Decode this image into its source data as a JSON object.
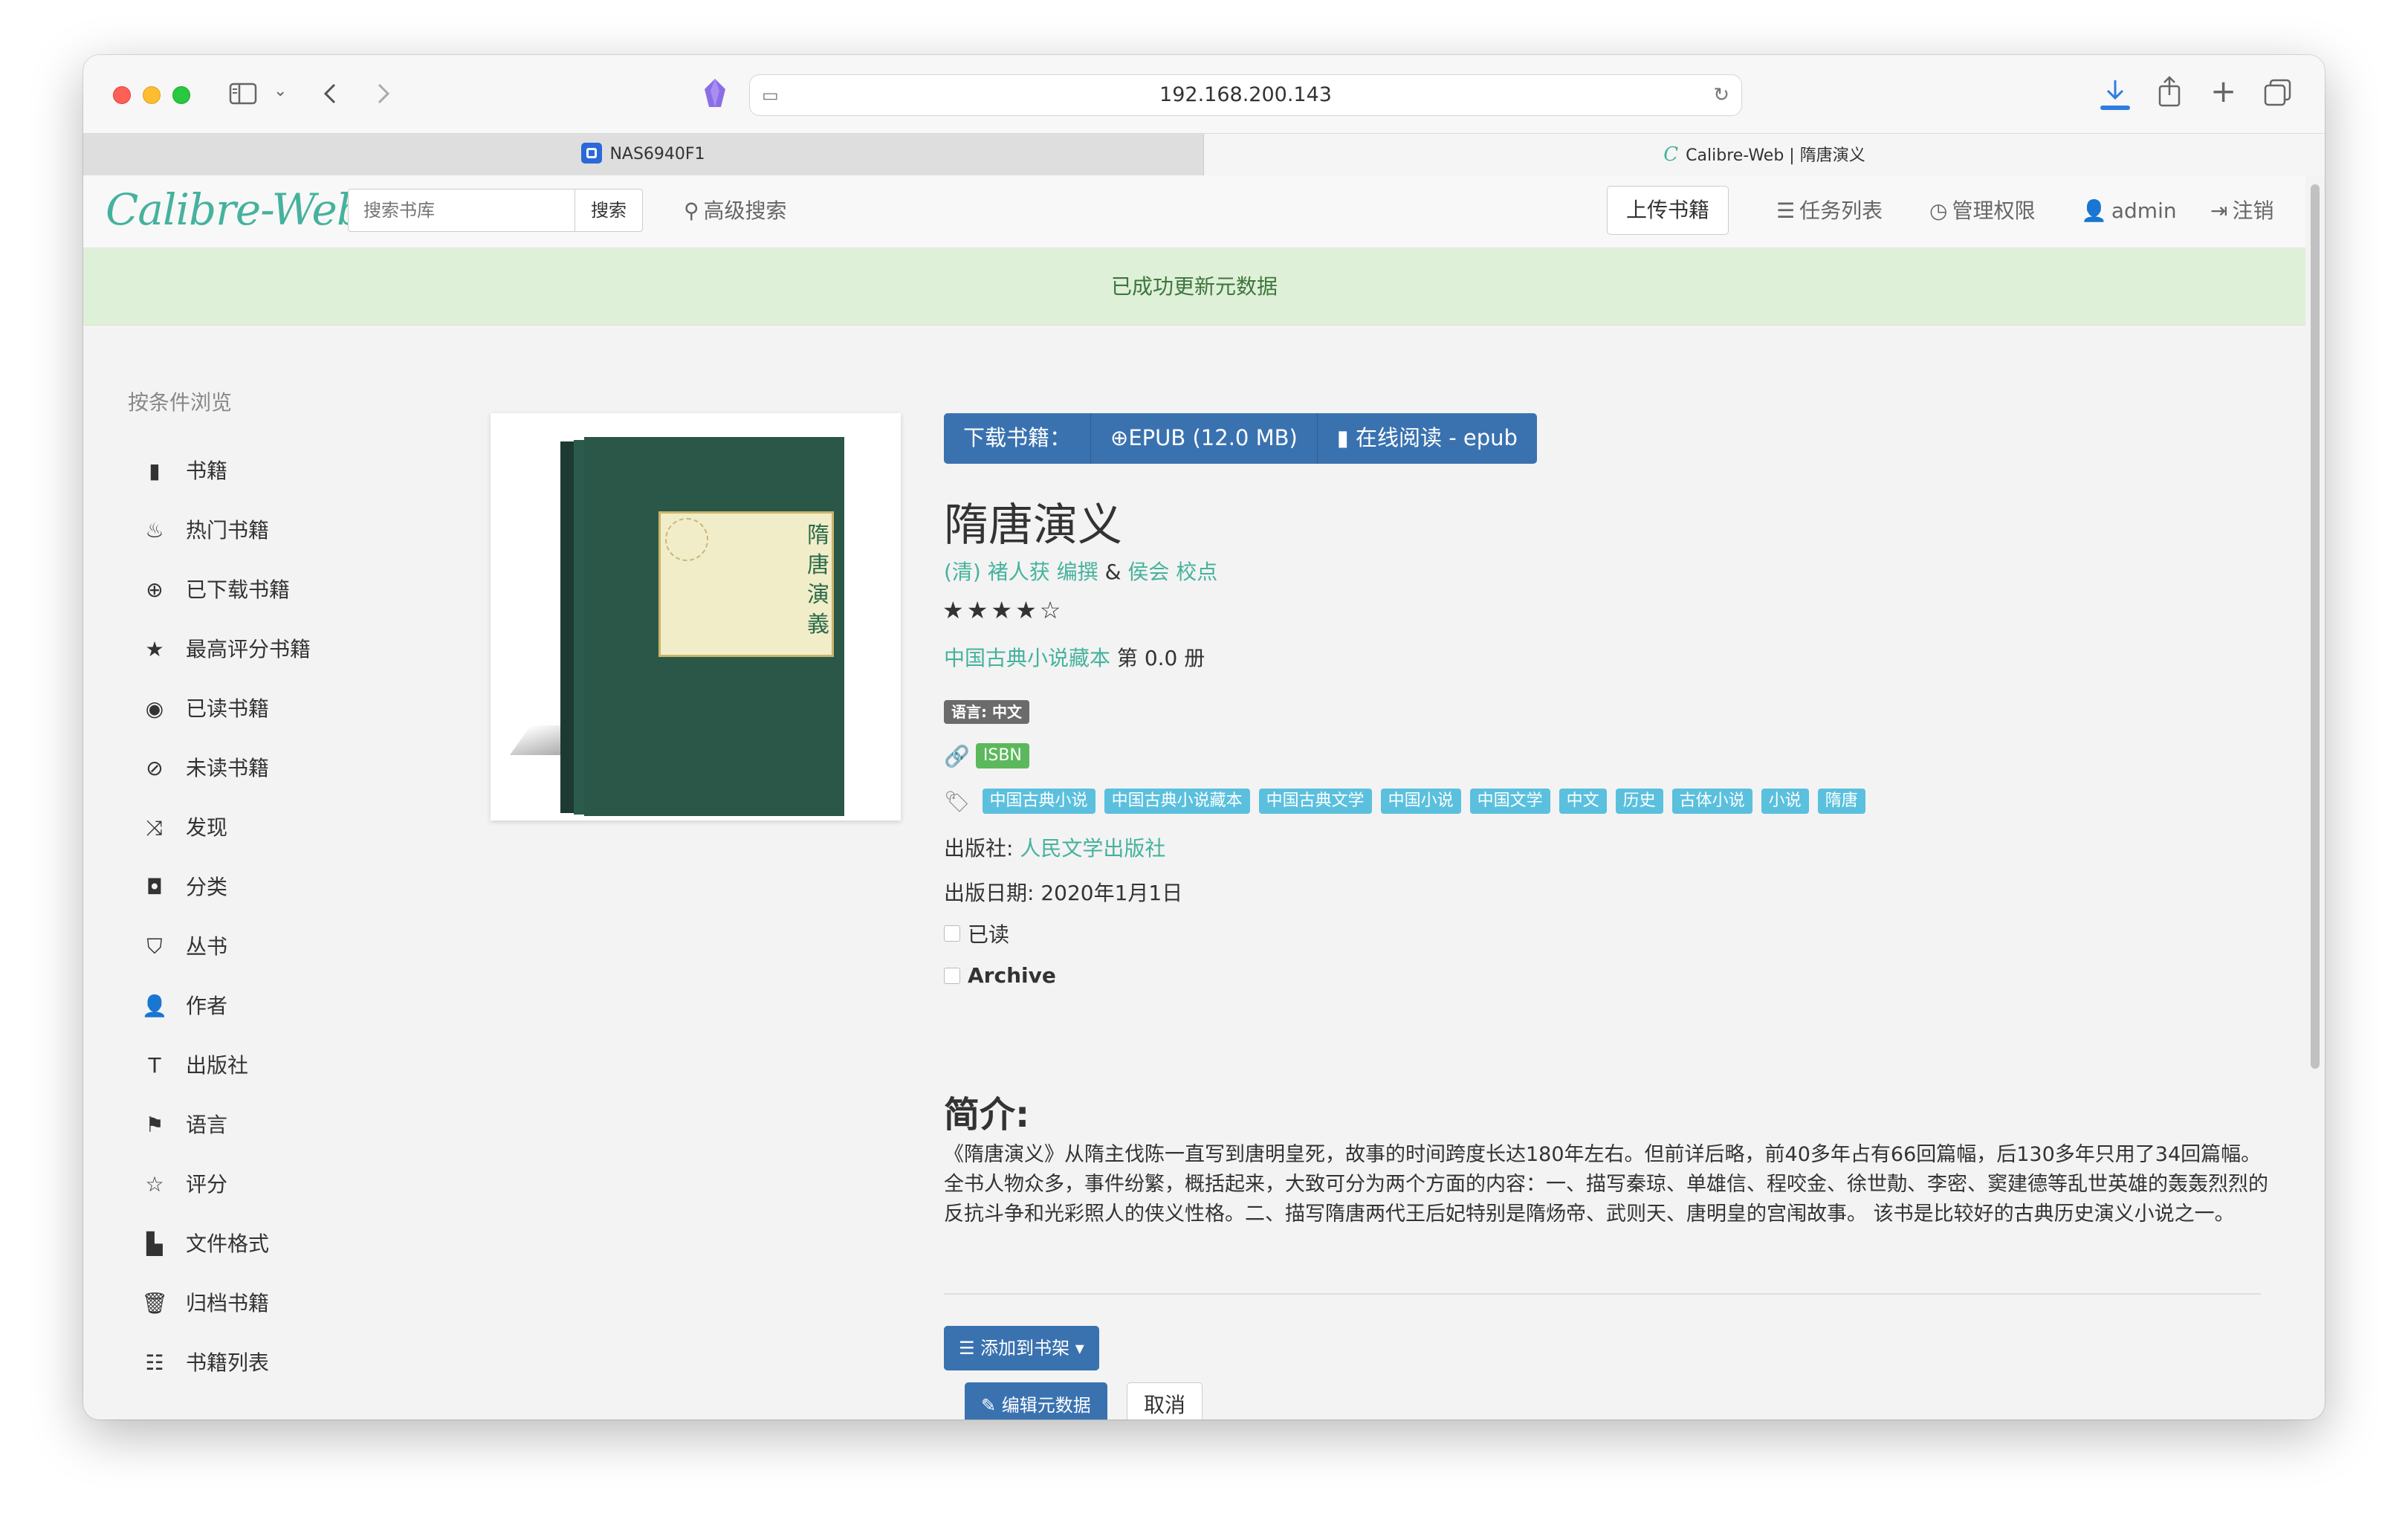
{
  "browser": {
    "url": "192.168.200.143",
    "tabs": [
      {
        "label": "NAS6940F1",
        "active": false
      },
      {
        "label": "Calibre-Web | 隋唐演义",
        "active": true
      }
    ]
  },
  "navbar": {
    "brand": "Calibre-Web",
    "search_placeholder": "搜索书库",
    "search_button": "搜索",
    "advanced_search": "高级搜索",
    "upload": "上传书籍",
    "tasks": "任务列表",
    "admin_rights": "管理权限",
    "user": "admin",
    "logout": "注销"
  },
  "alert": {
    "message": "已成功更新元数据"
  },
  "sidebar": {
    "heading": "按条件浏览",
    "items": [
      {
        "label": "书籍",
        "icon": "book-icon"
      },
      {
        "label": "热门书籍",
        "icon": "fire-icon"
      },
      {
        "label": "已下载书籍",
        "icon": "download-icon"
      },
      {
        "label": "最高评分书籍",
        "icon": "star-icon"
      },
      {
        "label": "已读书籍",
        "icon": "eye-icon"
      },
      {
        "label": "未读书籍",
        "icon": "eye-slash-icon"
      },
      {
        "label": "发现",
        "icon": "shuffle-icon"
      },
      {
        "label": "分类",
        "icon": "inbox-icon"
      },
      {
        "label": "丛书",
        "icon": "bookmark-icon"
      },
      {
        "label": "作者",
        "icon": "user-icon"
      },
      {
        "label": "出版社",
        "icon": "text-size-icon"
      },
      {
        "label": "语言",
        "icon": "flag-icon"
      },
      {
        "label": "评分",
        "icon": "star-empty-icon"
      },
      {
        "label": "文件格式",
        "icon": "file-icon"
      },
      {
        "label": "归档书籍",
        "icon": "trash-icon"
      },
      {
        "label": "书籍列表",
        "icon": "list-icon"
      }
    ]
  },
  "book": {
    "download_label": "下载书籍：",
    "epub_download": "EPUB (12.0 MB)",
    "read_online": "在线阅读 - epub",
    "title": "隋唐演义",
    "author_1": "(清) 褚人获 编撰",
    "author_sep": "&",
    "author_2": "侯会 校点",
    "rating": 4,
    "series_name": "中国古典小说藏本",
    "series_index": "第 0.0 册",
    "language": "语言: 中文",
    "isbn_label": "ISBN",
    "tags": [
      "中国古典小说",
      "中国古典小说藏本",
      "中国古典文学",
      "中国小说",
      "中国文学",
      "中文",
      "历史",
      "古体小说",
      "小说",
      "隋唐"
    ],
    "publisher_label": "出版社:",
    "publisher": "人民文学出版社",
    "pubdate": "出版日期: 2020年1月1日",
    "read_label": "已读",
    "archive_label": "Archive",
    "desc_heading": "简介:",
    "description": "《隋唐演义》从隋主伐陈一直写到唐明皇死，故事的时间跨度长达180年左右。但前详后略，前40多年占有66回篇幅，后130多年只用了34回篇幅。全书人物众多，事件纷繁，概括起来，大致可分为两个方面的内容：一、描写秦琼、单雄信、程咬金、徐世勣、李密、窦建德等乱世英雄的轰轰烈烈的反抗斗争和光彩照人的侠义性格。二、描写隋唐两代王后妃特别是隋炀帝、武则天、唐明皇的宫闱故事。 该书是比较好的古典历史演义小说之一。",
    "add_to_shelf": "添加到书架",
    "edit_metadata": "编辑元数据",
    "cancel": "取消"
  },
  "cover": {
    "title_chars": "隋唐演義"
  }
}
